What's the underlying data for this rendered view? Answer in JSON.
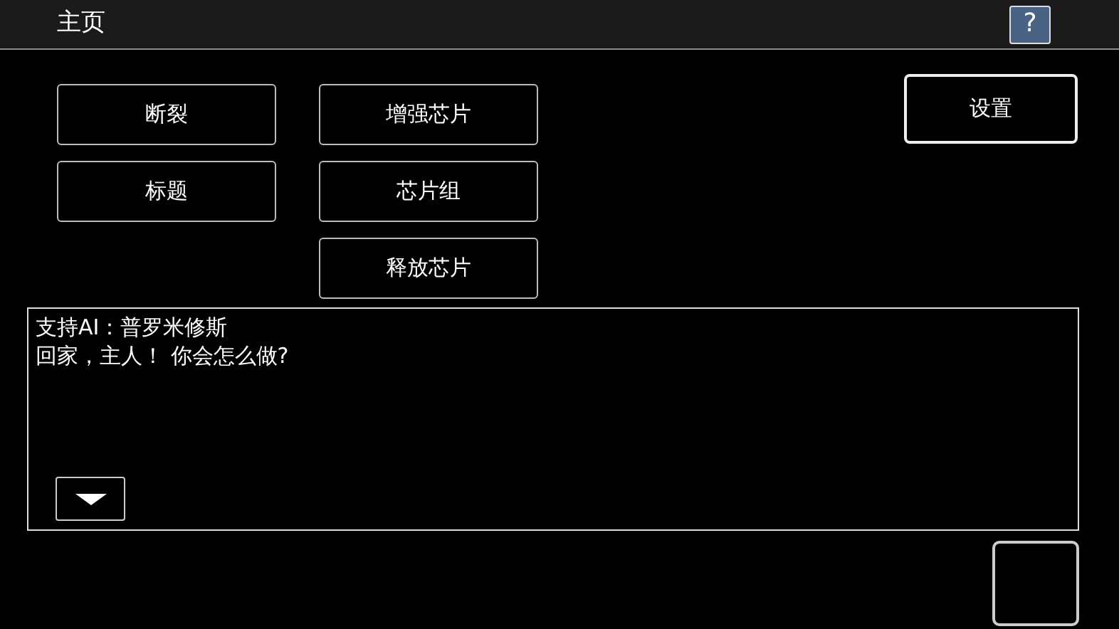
{
  "header": {
    "title": "主页",
    "help_button": "?"
  },
  "menu_columns": [
    [
      "断裂",
      "标题"
    ],
    [
      "增强芯片",
      "芯片组",
      "释放芯片"
    ]
  ],
  "settings_button": "设置",
  "dialog": {
    "lines": [
      "支持AI：普罗米修斯",
      "回家，主人！ 你会怎么做?"
    ]
  }
}
